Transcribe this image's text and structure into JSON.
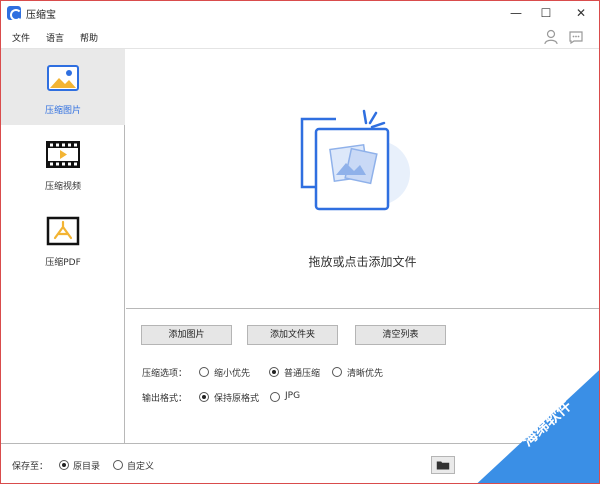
{
  "window": {
    "title": "压缩宝",
    "minimize": "—",
    "maximize": "☐",
    "close": "✕"
  },
  "menu": {
    "items": [
      "文件",
      "语言",
      "帮助"
    ]
  },
  "sidebar": {
    "items": [
      {
        "label": "压缩图片",
        "icon": "image-icon",
        "active": true
      },
      {
        "label": "压缩视频",
        "icon": "video-icon",
        "active": false
      },
      {
        "label": "压缩PDF",
        "icon": "pdf-icon",
        "active": false
      }
    ]
  },
  "dropzone": {
    "text": "拖放或点击添加文件"
  },
  "buttons": {
    "add_image": "添加图片",
    "add_folder": "添加文件夹",
    "clear_list": "清空列表"
  },
  "compression": {
    "label": "压缩选项：",
    "options": [
      "缩小优先",
      "普通压缩",
      "清晰优先"
    ],
    "selected": "普通压缩"
  },
  "output": {
    "label": "输出格式：",
    "options": [
      "保持原格式",
      "JPG"
    ],
    "selected": "保持原格式"
  },
  "save": {
    "label": "保存至：",
    "options": [
      "原目录",
      "自定义"
    ],
    "selected": "原目录"
  },
  "watermark": {
    "text": "海绵软件"
  },
  "colors": {
    "accent": "#2f6fe0",
    "watermark": "#3a8fe6",
    "border": "#d94c4c"
  }
}
